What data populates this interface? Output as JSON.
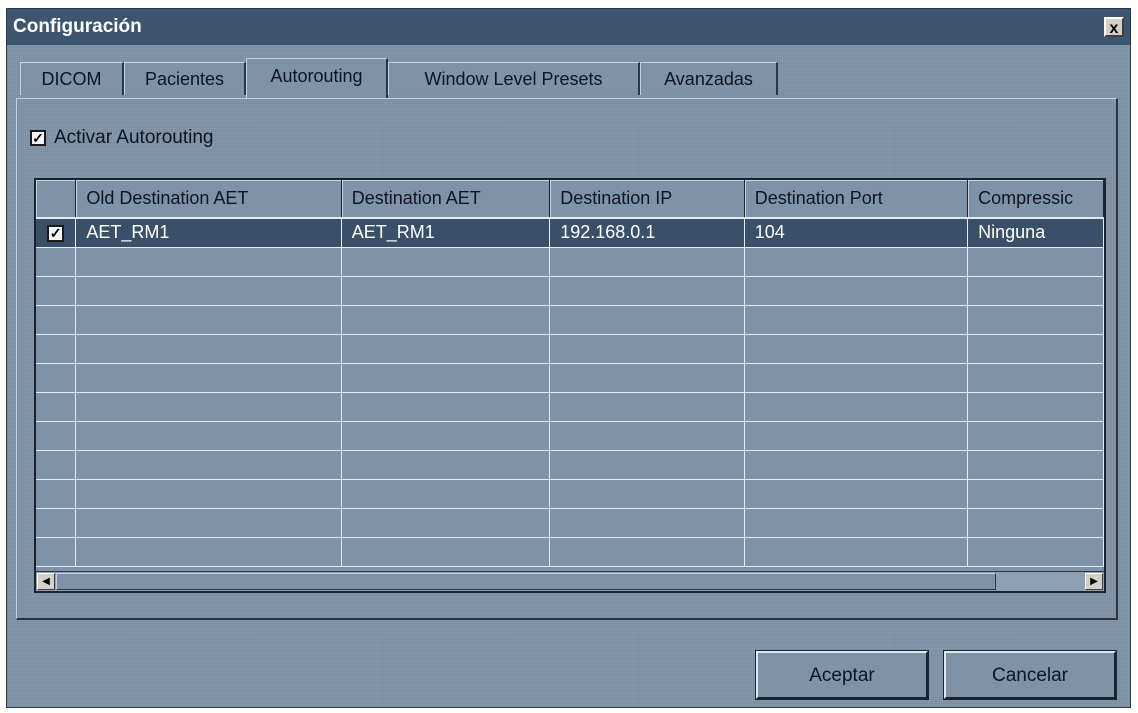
{
  "window": {
    "title": "Configuración",
    "close_label": "x"
  },
  "tabs": [
    {
      "label": "DICOM"
    },
    {
      "label": "Pacientes"
    },
    {
      "label": "Autorouting"
    },
    {
      "label": "Window Level Presets"
    },
    {
      "label": "Avanzadas"
    }
  ],
  "active_tab": "Autorouting",
  "autorouting": {
    "enable_label": "Activar Autorouting",
    "enable_checked": true
  },
  "table": {
    "columns": [
      "",
      "Old Destination AET",
      "Destination AET",
      "Destination IP",
      "Destination Port",
      "Compressic"
    ],
    "rows": [
      {
        "checked": true,
        "cells": [
          "AET_RM1",
          "AET_RM1",
          "192.168.0.1",
          "104",
          "Ninguna"
        ]
      }
    ]
  },
  "buttons": {
    "accept": "Aceptar",
    "cancel": "Cancelar"
  },
  "icons": {
    "close": "close-icon",
    "checkbox": "checkmark-icon",
    "scroll_left": "arrow-left-icon",
    "scroll_right": "arrow-right-icon"
  },
  "colors": {
    "background": "#7f93a8",
    "titlebar": "#3d556e",
    "selection": "#3a5068"
  }
}
